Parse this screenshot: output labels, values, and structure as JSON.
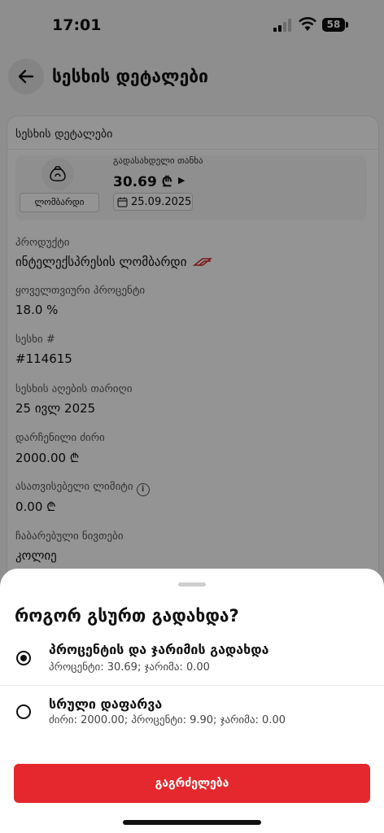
{
  "status_bar": {
    "time": "17:01",
    "battery": "58"
  },
  "header": {
    "title": "სესხის დეტალები"
  },
  "card": {
    "title": "სესხის დეტალები",
    "loan_type": "ლომბარდი",
    "payable_label": "გადასახდელი თანხა",
    "payable_amount": "30.69 ₾",
    "due_date": "25.09.2025",
    "fields": [
      {
        "label": "პროდუქტი",
        "value": "ინტელექსპრესის ლომბარდი"
      },
      {
        "label": "ყოველთვიური პროცენტი",
        "value": "18.0 %"
      },
      {
        "label": "სესხი #",
        "value": "#114615"
      },
      {
        "label": "სესხის აღების თარიღი",
        "value": "25 ივლ 2025"
      },
      {
        "label": "დარჩენილი ძირი",
        "value": "2000.00 ₾"
      },
      {
        "label": "ასათვისებელი ლიმიტი",
        "value": "0.00 ₾"
      },
      {
        "label": "ჩაბარებული ნივთები",
        "value": "კოლიე"
      }
    ]
  },
  "sheet": {
    "title": "როგორ გსურთ გადახდა?",
    "options": [
      {
        "title": "პროცენტის და ჯარიმის გადახდა",
        "subtitle": "პროცენტი: 30.69; ჯარიმა: 0.00",
        "selected": true
      },
      {
        "title": "სრული დაფარვა",
        "subtitle": "ძირი: 2000.00; პროცენტი: 9.90; ჯარიმა: 0.00",
        "selected": false
      }
    ],
    "continue_label": "გაგრძელება"
  },
  "colors": {
    "accent": "#e4282d",
    "overlay": "rgba(0,0,0,0.42)"
  },
  "icons": [
    "back-arrow-icon",
    "pawn-bag-icon",
    "calendar-icon",
    "info-icon",
    "brand-logo-icon",
    "signal-icon",
    "wifi-icon",
    "battery-icon"
  ]
}
